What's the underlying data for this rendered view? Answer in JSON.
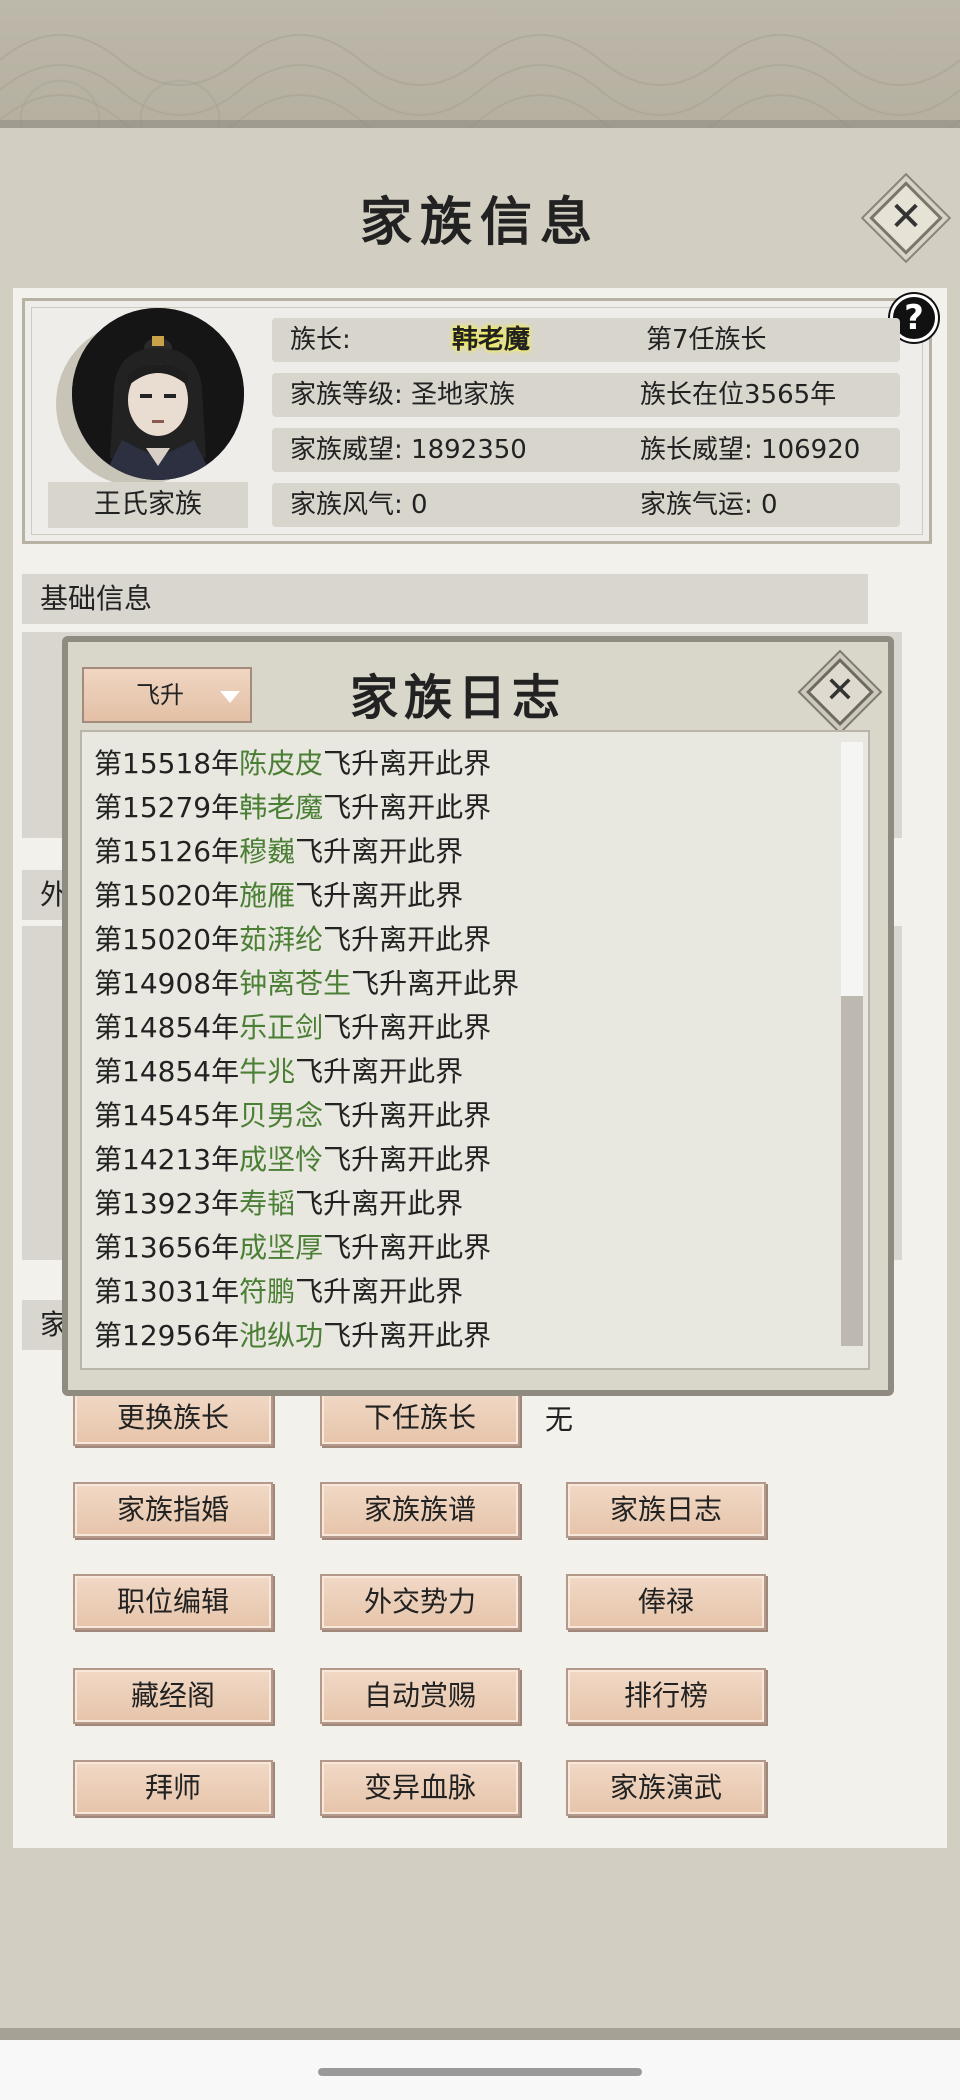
{
  "window": {
    "title": "家族信息"
  },
  "header": {
    "leader_label": "族长:",
    "leader_name": "韩老魔",
    "leader_rank": "第7任族长",
    "clan_level": "家族等级: 圣地家族",
    "leader_tenure": "族长在位3565年",
    "clan_prestige": "家族威望: 1892350",
    "leader_prestige": "族长威望: 106920",
    "clan_ethos": "家族风气: 0",
    "clan_luck": "家族气运: 0",
    "clan_name": "王氏家族",
    "help": "?"
  },
  "sections": {
    "basic": "基础信息",
    "outer_partial": "外",
    "family_partial": "家"
  },
  "log": {
    "title": "家族日志",
    "filter": "飞升",
    "suffix": "飞升离开此界",
    "entries": [
      {
        "year": "第15518年",
        "name": "陈皮皮"
      },
      {
        "year": "第15279年",
        "name": "韩老魔"
      },
      {
        "year": "第15126年",
        "name": "穆巍"
      },
      {
        "year": "第15020年",
        "name": "施雁"
      },
      {
        "year": "第15020年",
        "name": "茹湃纶"
      },
      {
        "year": "第14908年",
        "name": "钟离苍生"
      },
      {
        "year": "第14854年",
        "name": "乐正剑"
      },
      {
        "year": "第14854年",
        "name": "牛兆"
      },
      {
        "year": "第14545年",
        "name": "贝男念"
      },
      {
        "year": "第14213年",
        "name": "成坚怜"
      },
      {
        "year": "第13923年",
        "name": "寿韬"
      },
      {
        "year": "第13656年",
        "name": "成坚厚"
      },
      {
        "year": "第13031年",
        "name": "符鹏"
      },
      {
        "year": "第12956年",
        "name": "池纵功"
      }
    ]
  },
  "buttons": {
    "change_leader": "更换族长",
    "next_leader": "下任族长",
    "next_leader_value": "无",
    "marriage": "家族指婚",
    "genealogy": "家族族谱",
    "journal": "家族日志",
    "positions": "职位编辑",
    "diplomacy": "外交势力",
    "salary": "俸禄",
    "library": "藏经阁",
    "auto_reward": "自动赏赐",
    "ranking": "排行榜",
    "apprentice": "拜师",
    "bloodline": "变异血脉",
    "martial": "家族演武"
  },
  "colors": {
    "name_green": "#4a7f35",
    "button": "#e9c9b0",
    "panel": "#d2cec1"
  }
}
